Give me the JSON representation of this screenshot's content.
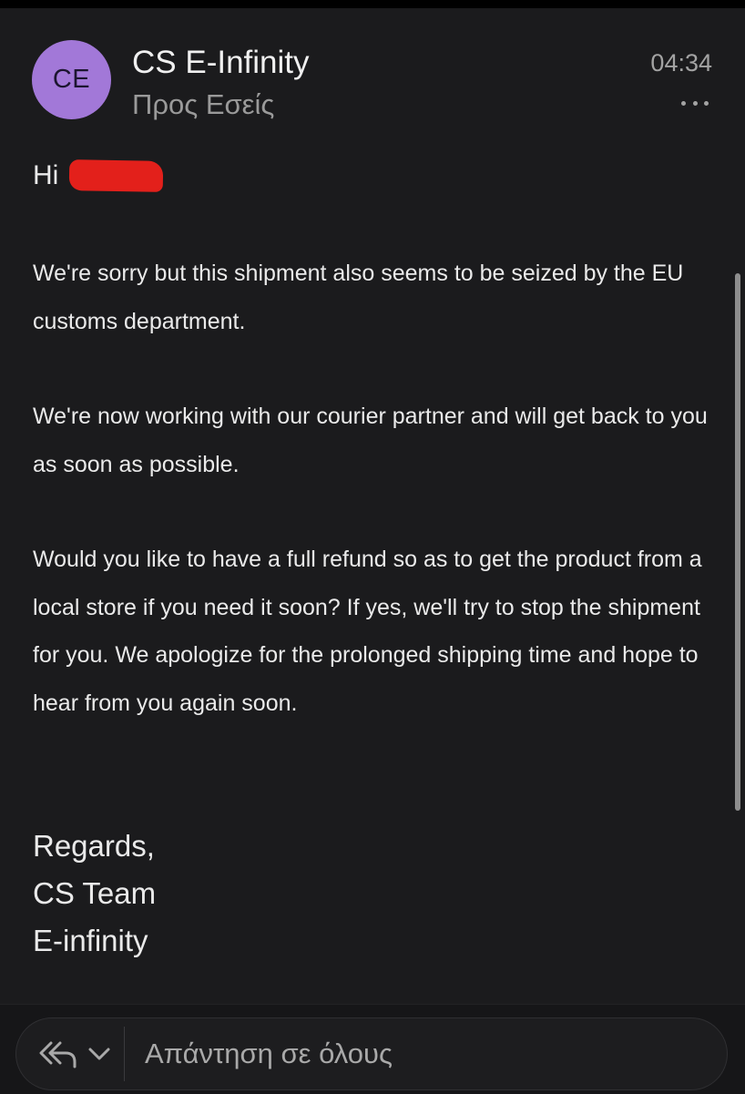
{
  "email": {
    "sender": {
      "initials": "CE",
      "name": "CS E-Infinity",
      "recipient_label": "Προς Εσείς",
      "avatar_color": "#a278d8"
    },
    "time": "04:34",
    "more_icon": "more-dots-icon",
    "body": {
      "greeting": "Hi",
      "paragraphs": [
        "We're sorry but this shipment also seems to be seized by the EU customs department.",
        "We're now working with our courier partner and will get back to you as soon as possible.",
        "Would you like to have a full refund so as to get the product from a local store if you need it soon? If yes, we'll try to stop the shipment for you. We apologize for the prolonged shipping time and hope to hear from you again soon."
      ],
      "signature": [
        "Regards,",
        "CS Team",
        "E-infinity"
      ]
    }
  },
  "footer": {
    "reply_all_icon": "reply-all-icon",
    "dropdown_icon": "chevron-down-icon",
    "reply_placeholder": "Απάντηση σε όλους"
  },
  "colors": {
    "background": "#1b1b1d",
    "redaction": "#e3201b"
  }
}
